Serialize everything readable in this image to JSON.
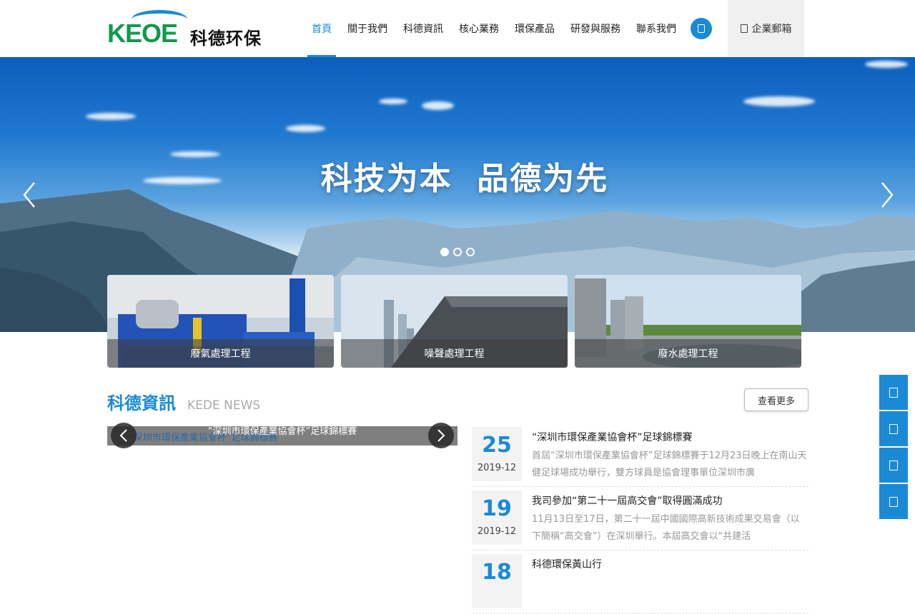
{
  "header": {
    "logo_mark": "KEOE",
    "logo_text": "科德环保",
    "nav": [
      {
        "label": "首頁",
        "active": true
      },
      {
        "label": "關于我們"
      },
      {
        "label": "科德資訊"
      },
      {
        "label": "核心業務"
      },
      {
        "label": "環保產品"
      },
      {
        "label": "研發與服務"
      },
      {
        "label": "聯系我們"
      }
    ],
    "search_icon": "search-icon",
    "mail_label": "企業郵箱",
    "mail_icon": "mail-icon"
  },
  "banner": {
    "slogan": "科技为本  品德为先",
    "slide_count": 3,
    "active_slide": 1
  },
  "services": [
    {
      "label": "廢氣處理工程"
    },
    {
      "label": "噪聲處理工程"
    },
    {
      "label": "廢水處理工程"
    }
  ],
  "news": {
    "title_cn": "科德資訊",
    "title_en": "KEDE NEWS",
    "more_label": "查看更多",
    "slider_caption": "“深圳市環保產業協會杯”足球錦標賽",
    "items": [
      {
        "day": "25",
        "month": "2019-12",
        "title": "“深圳市環保產業協會杯”足球錦標賽",
        "desc": "首屆“深圳市環保產業協會杯”足球錦標賽于12月23日晚上在南山天健足球場成功舉行，雙方球員是協會理事單位深圳市廣"
      },
      {
        "day": "19",
        "month": "2019-12",
        "title": "我司參加“第二十一屆高交會”取得圓滿成功",
        "desc": "11月13日至17日，第二十一屆中國國際高新技術成果交易會（以下簡稱“高交會”）在深圳舉行。本屆高交會以“共建活"
      },
      {
        "day": "18",
        "month": "",
        "title": "科德環保黃山行",
        "desc": ""
      }
    ]
  },
  "float_bar": [
    "phone-icon",
    "chat-icon",
    "wechat-icon",
    "top-icon"
  ],
  "colors": {
    "brand": "#1a8ad4",
    "logo_green": "#0f9a4c"
  }
}
